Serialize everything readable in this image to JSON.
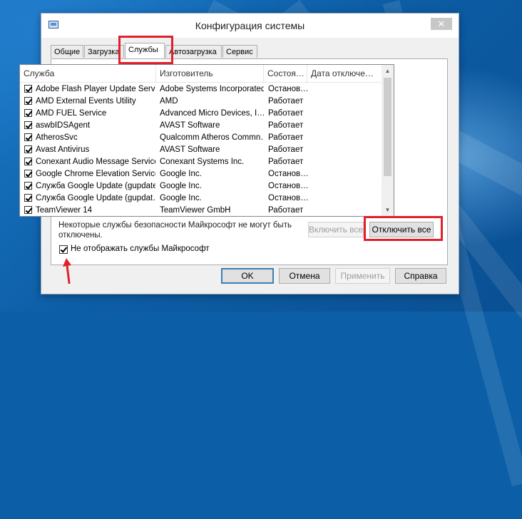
{
  "window": {
    "title": "Конфигурация системы",
    "close_glyph": "✕"
  },
  "tabs": [
    {
      "label": "Общие"
    },
    {
      "label": "Загрузка"
    },
    {
      "label": "Службы",
      "selected": true
    },
    {
      "label": "Автозагрузка"
    },
    {
      "label": "Сервис"
    }
  ],
  "services_table": {
    "columns": [
      "Служба",
      "Изготовитель",
      "Состоя…",
      "Дата отключе…"
    ],
    "rows": [
      {
        "checked": true,
        "service": "Adobe Flash Player Update Service",
        "manufacturer": "Adobe Systems Incorporated",
        "status": "Останов…",
        "date": ""
      },
      {
        "checked": true,
        "service": "AMD External Events Utility",
        "manufacturer": "AMD",
        "status": "Работает",
        "date": ""
      },
      {
        "checked": true,
        "service": "AMD FUEL Service",
        "manufacturer": "Advanced Micro Devices, I…",
        "status": "Работает",
        "date": ""
      },
      {
        "checked": true,
        "service": "aswbIDSAgent",
        "manufacturer": "AVAST Software",
        "status": "Работает",
        "date": ""
      },
      {
        "checked": true,
        "service": "AtherosSvc",
        "manufacturer": "Qualcomm Atheros Commn…",
        "status": "Работает",
        "date": ""
      },
      {
        "checked": true,
        "service": "Avast Antivirus",
        "manufacturer": "AVAST Software",
        "status": "Работает",
        "date": ""
      },
      {
        "checked": true,
        "service": "Conexant Audio Message Service",
        "manufacturer": "Conexant Systems Inc.",
        "status": "Работает",
        "date": ""
      },
      {
        "checked": true,
        "service": "Google Chrome Elevation Service",
        "manufacturer": "Google Inc.",
        "status": "Останов…",
        "date": ""
      },
      {
        "checked": true,
        "service": "Служба Google Update (gupdate)",
        "manufacturer": "Google Inc.",
        "status": "Останов…",
        "date": ""
      },
      {
        "checked": true,
        "service": "Служба Google Update (gupdat…",
        "manufacturer": "Google Inc.",
        "status": "Останов…",
        "date": ""
      },
      {
        "checked": true,
        "service": "TeamViewer 14",
        "manufacturer": "TeamViewer GmbH",
        "status": "Работает",
        "date": ""
      }
    ]
  },
  "note": "Некоторые службы безопасности Майкрософт не могут быть отключены.",
  "buttons": {
    "enable_all": "Включить все",
    "disable_all": "Отключить все",
    "ok": "OK",
    "cancel": "Отмена",
    "apply": "Применить",
    "help": "Справка"
  },
  "hide_ms_checkbox": {
    "label": "Не отображать службы Майкрософт",
    "checked": true
  },
  "icons": {
    "app": "msconfig-icon",
    "scroll_up": "▲",
    "scroll_down": "▼"
  },
  "colors": {
    "highlight": "#e0212b",
    "desktop_blue": "#0d5ea6"
  }
}
